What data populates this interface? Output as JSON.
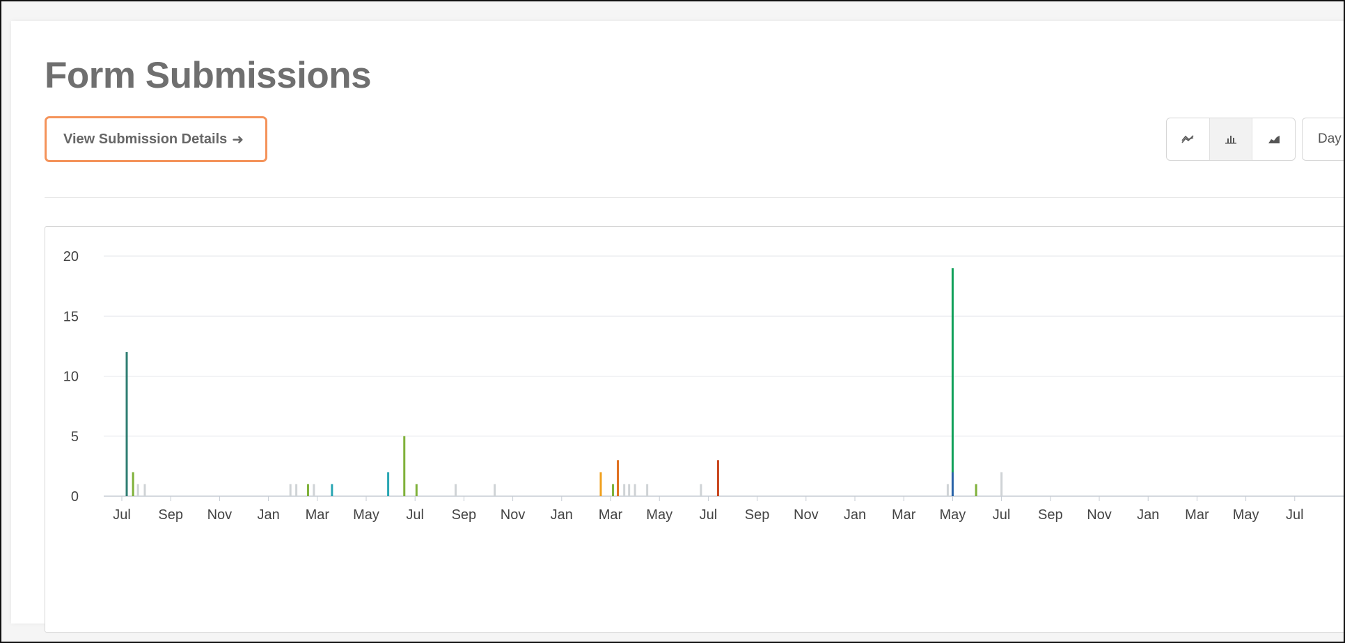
{
  "page": {
    "title": "Form Submissions",
    "details_button": {
      "label": "View Submission Details",
      "arrow": "➜"
    },
    "chart_type_buttons": [
      {
        "name": "line-chart-icon",
        "active": false
      },
      {
        "name": "bar-chart-icon",
        "active": true
      },
      {
        "name": "area-chart-icon",
        "active": false
      }
    ],
    "period_button": {
      "label": "Day"
    },
    "colors": {
      "accent_border": "#f4935a",
      "muted": "#cfd3d6"
    }
  },
  "chart_data": {
    "type": "bar",
    "title": "",
    "xlabel": "",
    "ylabel": "",
    "ylim": [
      0,
      20
    ],
    "y_ticks": [
      0,
      5,
      10,
      15,
      20
    ],
    "x_ticks": [
      "Jul",
      "Sep",
      "Nov",
      "Jan",
      "Mar",
      "May",
      "Jul",
      "Sep",
      "Nov",
      "Jan",
      "Mar",
      "May",
      "Jul",
      "Sep",
      "Nov",
      "Jan",
      "Mar",
      "May",
      "Jul",
      "Sep",
      "Nov",
      "Jan",
      "Mar",
      "May",
      "Jul"
    ],
    "grid": true,
    "bars": [
      {
        "t": 0.1,
        "value": 12,
        "color": "#2f7d72"
      },
      {
        "t": 0.23,
        "value": 2,
        "color": "#7fb13a"
      },
      {
        "t": 0.33,
        "value": 1,
        "color": "#cfd3d6"
      },
      {
        "t": 0.47,
        "value": 1,
        "color": "#cfd3d6"
      },
      {
        "t": 3.45,
        "value": 1,
        "color": "#cfd3d6"
      },
      {
        "t": 3.57,
        "value": 1,
        "color": "#cfd3d6"
      },
      {
        "t": 3.81,
        "value": 1,
        "color": "#7fb13a"
      },
      {
        "t": 3.93,
        "value": 1,
        "color": "#cfd3d6"
      },
      {
        "t": 4.3,
        "value": 1,
        "color": "#29a6b3"
      },
      {
        "t": 5.45,
        "value": 2,
        "color": "#29a6b3"
      },
      {
        "t": 5.78,
        "value": 5,
        "color": "#7fb13a"
      },
      {
        "t": 6.03,
        "value": 1,
        "color": "#7fb13a"
      },
      {
        "t": 6.83,
        "value": 1,
        "color": "#cfd3d6"
      },
      {
        "t": 7.63,
        "value": 1,
        "color": "#cfd3d6"
      },
      {
        "t": 9.8,
        "value": 2,
        "color": "#f0a01e"
      },
      {
        "t": 10.05,
        "value": 1,
        "color": "#7fb13a"
      },
      {
        "t": 10.15,
        "value": 3,
        "color": "#e0701e"
      },
      {
        "t": 10.28,
        "value": 1,
        "color": "#cfd3d6"
      },
      {
        "t": 10.38,
        "value": 1,
        "color": "#cfd3d6"
      },
      {
        "t": 10.5,
        "value": 1,
        "color": "#cfd3d6"
      },
      {
        "t": 10.75,
        "value": 1,
        "color": "#cfd3d6"
      },
      {
        "t": 11.85,
        "value": 1,
        "color": "#cfd3d6"
      },
      {
        "t": 12.2,
        "value": 3,
        "color": "#c9451c"
      },
      {
        "t": 16.9,
        "value": 1,
        "color": "#cfd3d6"
      },
      {
        "t": 17.0,
        "value": 19,
        "segments": [
          {
            "value": 2,
            "color": "#2a64a8"
          },
          {
            "value": 17,
            "color": "#11a05a"
          }
        ]
      },
      {
        "t": 17.48,
        "value": 1,
        "color": "#7fb13a"
      },
      {
        "t": 18.0,
        "value": 2,
        "color": "#cfd3d6"
      }
    ]
  }
}
